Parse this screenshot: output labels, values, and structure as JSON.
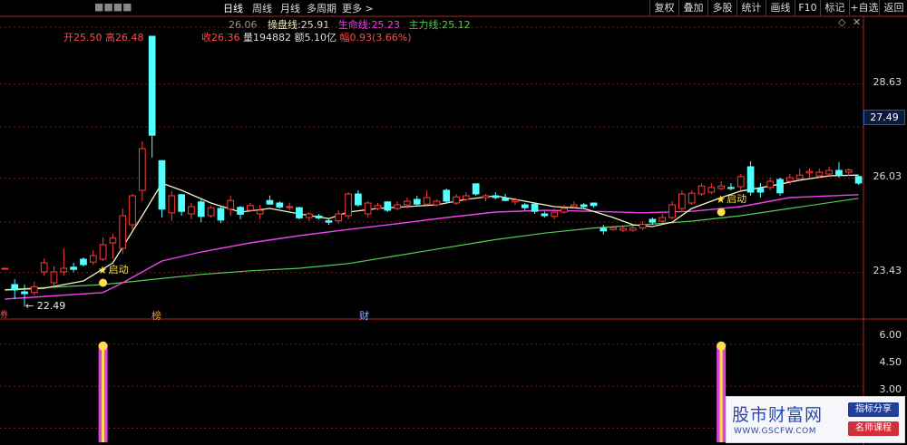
{
  "toolbar": {
    "security_name": "■■■■",
    "period_tabs": [
      "日线",
      "周线",
      "月线",
      "多周期",
      "更多 >"
    ],
    "buttons": [
      "复权",
      "叠加",
      "多股",
      "统计",
      "画线",
      "F10",
      "标记",
      "+自选",
      "返回"
    ]
  },
  "legend": {
    "value_prefix": "26.06",
    "items": [
      {
        "label": "操盘线:",
        "value": "25.91",
        "color": "#f5f5c8"
      },
      {
        "label": "生命线:",
        "value": "25.23",
        "color": "#ee44ee"
      },
      {
        "label": "主力线:",
        "value": "25.12",
        "color": "#55cc55"
      }
    ]
  },
  "info": {
    "open": "开25.50",
    "high": "高26.48",
    "close": "收26.36",
    "volume": "量194882",
    "amount": "额5.10亿",
    "change": "幅0.93(3.66%)"
  },
  "colors": {
    "up": "#ff3a3a",
    "down": "#54ffff",
    "grid": "#7a1818",
    "trader_line": "#f5f5c8",
    "life_line": "#ee44ee",
    "main_line": "#55cc55",
    "annot": "#ffe04a"
  },
  "y_axis": {
    "price_ticks": [
      "28.63",
      "26.03",
      "23.43"
    ],
    "current_price": "27.49",
    "indicator_ticks": [
      "6.00",
      "4.50",
      "3.00"
    ]
  },
  "annotations": {
    "signal_label": "启动",
    "low_marker": "← 22.49",
    "bottom_marks": [
      "榜",
      "财"
    ],
    "left_edge_mark": "券"
  },
  "chart_data": {
    "type": "candlestick",
    "ylim": [
      22.2,
      30.2
    ],
    "candles": [
      [
        23.55,
        23.55,
        23.55,
        23.55,
        "up"
      ],
      [
        23.1,
        22.95,
        23.25,
        22.7,
        "down"
      ],
      [
        22.9,
        22.85,
        23.1,
        22.49,
        "down"
      ],
      [
        22.88,
        23.04,
        23.18,
        22.8,
        "up"
      ],
      [
        23.45,
        23.7,
        23.82,
        23.35,
        "up"
      ],
      [
        23.15,
        23.45,
        23.6,
        23.05,
        "up"
      ],
      [
        23.45,
        23.55,
        24.1,
        23.35,
        "up"
      ],
      [
        23.58,
        23.52,
        23.7,
        23.45,
        "down"
      ],
      [
        23.8,
        23.65,
        23.85,
        23.6,
        "down"
      ],
      [
        23.72,
        23.9,
        24.05,
        23.65,
        "up"
      ],
      [
        23.8,
        24.2,
        24.4,
        23.75,
        "up"
      ],
      [
        24.25,
        24.38,
        24.5,
        23.8,
        "up"
      ],
      [
        24.1,
        25.0,
        25.2,
        23.95,
        "up"
      ],
      [
        24.75,
        25.55,
        25.6,
        24.6,
        "up"
      ],
      [
        25.7,
        26.85,
        27.05,
        25.4,
        "up"
      ],
      [
        29.95,
        27.22,
        29.95,
        26.6,
        "down"
      ],
      [
        26.52,
        25.18,
        26.52,
        24.95,
        "down"
      ],
      [
        25.08,
        25.55,
        25.68,
        24.85,
        "up"
      ],
      [
        25.58,
        25.12,
        25.6,
        25.0,
        "down"
      ],
      [
        25.05,
        25.25,
        25.35,
        24.9,
        "up"
      ],
      [
        25.38,
        24.98,
        25.45,
        24.82,
        "down"
      ],
      [
        25.0,
        25.22,
        25.28,
        24.95,
        "up"
      ],
      [
        25.2,
        24.88,
        25.25,
        24.8,
        "down"
      ],
      [
        25.18,
        25.42,
        25.55,
        25.0,
        "up"
      ],
      [
        25.23,
        25.04,
        25.27,
        24.9,
        "down"
      ],
      [
        25.15,
        25.28,
        25.35,
        25.1,
        "up"
      ],
      [
        25.05,
        25.15,
        25.3,
        24.9,
        "up"
      ],
      [
        25.42,
        25.32,
        25.56,
        25.3,
        "down"
      ],
      [
        25.35,
        25.24,
        25.4,
        25.2,
        "down"
      ],
      [
        25.25,
        25.24,
        25.36,
        25.14,
        "up"
      ],
      [
        25.22,
        24.94,
        25.25,
        24.9,
        "down"
      ],
      [
        25.05,
        24.95,
        25.1,
        24.85,
        "up"
      ],
      [
        24.99,
        24.94,
        25.05,
        24.9,
        "down"
      ],
      [
        24.86,
        24.82,
        24.92,
        24.75,
        "down"
      ],
      [
        24.86,
        25.05,
        25.15,
        24.78,
        "up"
      ],
      [
        25.0,
        25.6,
        25.65,
        24.9,
        "up"
      ],
      [
        25.6,
        25.3,
        25.7,
        25.25,
        "down"
      ],
      [
        25.05,
        25.35,
        25.4,
        24.95,
        "up"
      ],
      [
        25.2,
        25.28,
        25.35,
        25.15,
        "up"
      ],
      [
        25.38,
        25.15,
        25.4,
        25.1,
        "down"
      ],
      [
        25.2,
        25.3,
        25.4,
        25.15,
        "up"
      ],
      [
        25.3,
        25.4,
        25.5,
        25.2,
        "up"
      ],
      [
        25.45,
        25.32,
        25.55,
        25.28,
        "down"
      ],
      [
        25.32,
        25.5,
        25.7,
        25.25,
        "up"
      ],
      [
        25.3,
        25.4,
        25.45,
        25.25,
        "up"
      ],
      [
        25.7,
        25.4,
        25.75,
        25.35,
        "down"
      ],
      [
        25.35,
        25.52,
        25.6,
        25.3,
        "up"
      ],
      [
        25.45,
        25.55,
        25.65,
        25.4,
        "up"
      ],
      [
        25.88,
        25.6,
        25.88,
        25.55,
        "down"
      ],
      [
        25.5,
        25.55,
        25.6,
        25.4,
        "up"
      ],
      [
        25.55,
        25.5,
        25.65,
        25.45,
        "down"
      ],
      [
        25.48,
        25.42,
        25.6,
        25.4,
        "down"
      ],
      [
        25.38,
        25.43,
        25.5,
        25.3,
        "up"
      ],
      [
        25.3,
        25.22,
        25.35,
        25.15,
        "down"
      ],
      [
        25.32,
        25.12,
        25.35,
        25.05,
        "down"
      ],
      [
        25.05,
        25.0,
        25.12,
        24.95,
        "down"
      ],
      [
        24.98,
        25.1,
        25.2,
        24.9,
        "up"
      ],
      [
        25.1,
        25.2,
        25.3,
        25.05,
        "up"
      ],
      [
        25.25,
        25.3,
        25.4,
        25.2,
        "up"
      ],
      [
        25.3,
        25.25,
        25.35,
        25.2,
        "down"
      ],
      [
        25.35,
        25.28,
        25.36,
        25.22,
        "down"
      ],
      [
        24.65,
        24.58,
        24.75,
        24.48,
        "down"
      ],
      [
        24.62,
        24.67,
        24.72,
        24.58,
        "up"
      ],
      [
        24.6,
        24.65,
        24.7,
        24.55,
        "up"
      ],
      [
        24.6,
        24.66,
        24.72,
        24.55,
        "up"
      ],
      [
        24.66,
        24.76,
        24.85,
        24.6,
        "up"
      ],
      [
        24.9,
        24.82,
        24.95,
        24.75,
        "down"
      ],
      [
        24.85,
        24.95,
        25.05,
        24.8,
        "up"
      ],
      [
        24.95,
        25.3,
        25.4,
        24.9,
        "up"
      ],
      [
        25.2,
        25.6,
        25.7,
        25.1,
        "up"
      ],
      [
        25.35,
        25.62,
        25.7,
        25.3,
        "up"
      ],
      [
        25.6,
        25.82,
        25.9,
        25.55,
        "up"
      ],
      [
        25.65,
        25.78,
        25.9,
        25.6,
        "up"
      ],
      [
        25.75,
        25.82,
        25.95,
        25.7,
        "up"
      ],
      [
        25.78,
        25.75,
        25.9,
        25.7,
        "down"
      ],
      [
        25.8,
        26.08,
        26.15,
        25.7,
        "up"
      ],
      [
        26.35,
        25.65,
        26.5,
        25.55,
        "down"
      ],
      [
        25.75,
        25.65,
        25.9,
        25.5,
        "down"
      ],
      [
        25.78,
        25.95,
        26.05,
        25.7,
        "up"
      ],
      [
        26.0,
        25.63,
        26.05,
        25.55,
        "down"
      ],
      [
        25.95,
        26.05,
        26.15,
        25.85,
        "up"
      ],
      [
        26.02,
        26.12,
        26.3,
        25.95,
        "up"
      ],
      [
        26.18,
        26.22,
        26.3,
        26.05,
        "up"
      ],
      [
        26.1,
        26.2,
        26.3,
        26.05,
        "up"
      ],
      [
        26.15,
        26.25,
        26.35,
        26.1,
        "up"
      ],
      [
        26.25,
        26.12,
        26.48,
        26.05,
        "down"
      ],
      [
        26.2,
        26.26,
        26.3,
        26.1,
        "up"
      ],
      [
        26.08,
        25.9,
        26.1,
        25.85,
        "down"
      ]
    ],
    "trader_line": [
      [
        0,
        22.95
      ],
      [
        4,
        23.0
      ],
      [
        8,
        23.2
      ],
      [
        11,
        23.7
      ],
      [
        14,
        25.0
      ],
      [
        16,
        25.9
      ],
      [
        18,
        25.7
      ],
      [
        21,
        25.35
      ],
      [
        24,
        25.1
      ],
      [
        27,
        25.2
      ],
      [
        30,
        25.05
      ],
      [
        33,
        24.92
      ],
      [
        35,
        25.1
      ],
      [
        38,
        25.2
      ],
      [
        41,
        25.25
      ],
      [
        44,
        25.3
      ],
      [
        47,
        25.45
      ],
      [
        50,
        25.55
      ],
      [
        53,
        25.4
      ],
      [
        56,
        25.25
      ],
      [
        59,
        25.2
      ],
      [
        62,
        24.95
      ],
      [
        64,
        24.75
      ],
      [
        66,
        24.7
      ],
      [
        68,
        24.82
      ],
      [
        70,
        25.2
      ],
      [
        73,
        25.5
      ],
      [
        75,
        25.68
      ],
      [
        78,
        25.82
      ],
      [
        81,
        25.98
      ],
      [
        84,
        26.1
      ],
      [
        87,
        26.12
      ]
    ],
    "life_line": [
      [
        0,
        22.7
      ],
      [
        10,
        22.88
      ],
      [
        12,
        23.15
      ],
      [
        14,
        23.45
      ],
      [
        16,
        23.75
      ],
      [
        20,
        24.0
      ],
      [
        25,
        24.25
      ],
      [
        30,
        24.45
      ],
      [
        35,
        24.62
      ],
      [
        40,
        24.78
      ],
      [
        45,
        24.95
      ],
      [
        50,
        25.1
      ],
      [
        55,
        25.15
      ],
      [
        60,
        25.12
      ],
      [
        65,
        25.08
      ],
      [
        70,
        25.12
      ],
      [
        75,
        25.25
      ],
      [
        80,
        25.5
      ],
      [
        87,
        25.58
      ]
    ],
    "main_line": [
      [
        0,
        22.96
      ],
      [
        10,
        23.1
      ],
      [
        15,
        23.24
      ],
      [
        20,
        23.38
      ],
      [
        25,
        23.48
      ],
      [
        30,
        23.55
      ],
      [
        35,
        23.68
      ],
      [
        40,
        23.9
      ],
      [
        45,
        24.12
      ],
      [
        50,
        24.34
      ],
      [
        55,
        24.52
      ],
      [
        60,
        24.66
      ],
      [
        65,
        24.75
      ],
      [
        70,
        24.85
      ],
      [
        75,
        25.0
      ],
      [
        80,
        25.2
      ],
      [
        87,
        25.48
      ]
    ],
    "signals": [
      {
        "bar": 10
      },
      {
        "bar": 73
      }
    ],
    "indicator": {
      "ylim": [
        2.5,
        6.8
      ],
      "bars": [
        {
          "bar": 10,
          "value": 6.0
        },
        {
          "bar": 73,
          "value": 6.0
        }
      ]
    }
  },
  "watermark": {
    "title": "股市财富网",
    "url": "WWW.GSCFW.COM",
    "btn1": "指标分享",
    "btn2": "名师课程"
  }
}
